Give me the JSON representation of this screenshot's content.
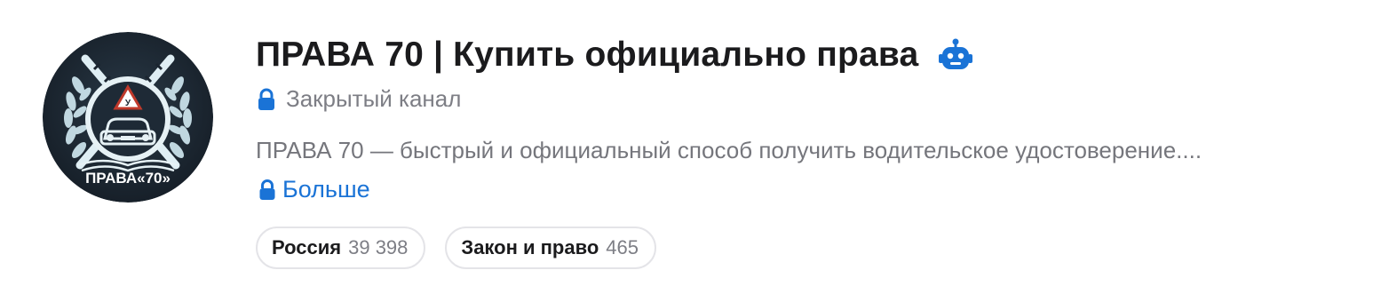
{
  "channel": {
    "title": "ПРАВА 70 | Купить официально права",
    "status": "Закрытый канал",
    "description": "ПРАВА 70 — быстрый и официальный способ получить водительское удостоверение....",
    "more_label": "Больше",
    "avatar": {
      "icon": "driving-school-emblem",
      "badge_text": "ПРАВА«70»",
      "sign_letter": "У",
      "background": "#1b2530"
    },
    "bot_icon": "robot-icon",
    "accent_color": "#1a73d6"
  },
  "tags": [
    {
      "name": "Россия",
      "count": "39 398"
    },
    {
      "name": "Закон и право",
      "count": "465"
    }
  ]
}
